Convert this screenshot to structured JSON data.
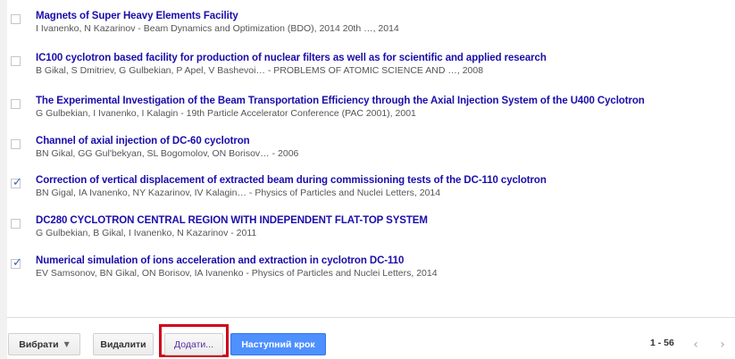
{
  "results": [
    {
      "title": "Magnets of Super Heavy Elements Facility",
      "meta": "I Ivanenko, N Kazarinov - Beam Dynamics and Optimization (BDO), 2014 20th …, 2014",
      "checked": false
    },
    {
      "title": "IC100 cyclotron based facility for production of nuclear filters as well as for scientific and applied research",
      "meta": "B Gikal, S Dmitriev, G Gulbekian, P Apel, V Bashevoi… - PROBLEMS OF ATOMIC SCIENCE AND …, 2008",
      "checked": false
    },
    {
      "title": "The Experimental Investigation of the Beam Transportation Efficiency through the Axial Injection System of the U400 Cyclotron",
      "meta": "G Gulbekian, I Ivanenko, I Kalagin - 19th Particle Accelerator Conference (PAC 2001), 2001",
      "checked": false
    },
    {
      "title": "Channel of axial injection of DC-60 cyclotron",
      "meta": "BN Gikal, GG Gul'bekyan, SL Bogomolov, ON Borisov… - 2006",
      "checked": false
    },
    {
      "title": "Correction of vertical displacement of extracted beam during commissioning tests of the DC-110 cyclotron",
      "meta": "BN Gigal, IA Ivanenko, NY Kazarinov, IV Kalagin… - Physics of Particles and Nuclei Letters, 2014",
      "checked": true
    },
    {
      "title": "DC280 CYCLOTRON CENTRAL REGION WITH INDEPENDENT FLAT-TOP SYSTEM",
      "meta": "G Gulbekian, B Gikal, I Ivanenko, N Kazarinov - 2011",
      "checked": false
    },
    {
      "title": "Numerical simulation of ions acceleration and extraction in cyclotron DC-110",
      "meta": "EV Samsonov, BN Gikal, ON Borisov, IA Ivanenko - Physics of Particles and Nuclei Letters, 2014",
      "checked": true
    }
  ],
  "toolbar": {
    "select_label": "Вибрати",
    "delete_label": "Видалити",
    "add_label": "Додати...",
    "next_label": "Наступний крок"
  },
  "pager": {
    "range": "1 - 56",
    "prev": "‹",
    "next": "›"
  },
  "icons": {
    "check": "✓",
    "caret": "▼"
  },
  "colors": {
    "title_link": "#1a0dab",
    "primary_button": "#4d90fe",
    "highlight_box": "#d0021b"
  }
}
